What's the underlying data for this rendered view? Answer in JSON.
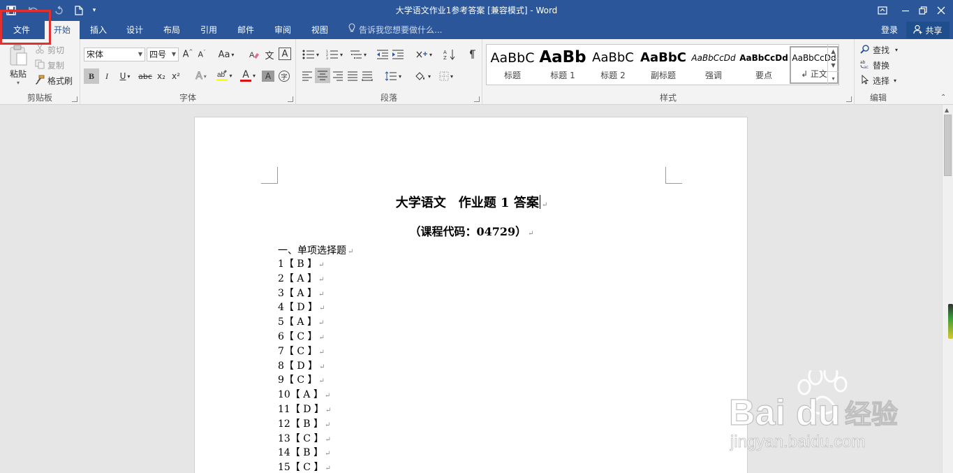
{
  "window": {
    "title": "大学语文作业1参考答案 [兼容模式] - Word"
  },
  "tabs": {
    "file": "文件",
    "items": [
      {
        "label": "开始",
        "active": true
      },
      {
        "label": "插入"
      },
      {
        "label": "设计"
      },
      {
        "label": "布局"
      },
      {
        "label": "引用"
      },
      {
        "label": "邮件"
      },
      {
        "label": "审阅"
      },
      {
        "label": "视图"
      }
    ],
    "tell_me": "告诉我您想要做什么...",
    "login": "登录",
    "share": "共享"
  },
  "ribbon": {
    "clipboard": {
      "label": "剪贴板",
      "paste": "粘贴",
      "cut": "剪切",
      "copy": "复制",
      "format_painter": "格式刷"
    },
    "font": {
      "label": "字体",
      "font_name": "宋体",
      "font_size": "四号",
      "change_case": "Aa",
      "bold": "B",
      "italic": "I",
      "underline": "U",
      "strikethrough": "abc",
      "subscript": "x₂",
      "superscript": "x²",
      "phonetic": "文",
      "char_border": "A",
      "font_color_letter": "A",
      "char_shading": "A",
      "enclose": "字"
    },
    "paragraph": {
      "label": "段落"
    },
    "styles": {
      "label": "样式",
      "items": [
        {
          "preview": "AaBbC",
          "name": "标题"
        },
        {
          "preview": "AaBb",
          "name": "标题 1"
        },
        {
          "preview": "AaBbC",
          "name": "标题 2"
        },
        {
          "preview": "AaBbC",
          "name": "副标题"
        },
        {
          "preview": "AaBbCcDd",
          "name": "强调"
        },
        {
          "preview": "AaBbCcDd",
          "name": "要点"
        },
        {
          "preview": "AaBbCcDd",
          "name": "↲ 正文"
        }
      ]
    },
    "editing": {
      "label": "编辑",
      "find": "查找",
      "replace": "替换",
      "select": "选择"
    }
  },
  "document": {
    "heading": "大学语文　作业题 1 答案",
    "subheading": "（课程代码：04729）",
    "section": "一、单项选择题",
    "paragraph_mark": "↵",
    "answers": [
      {
        "num": "1",
        "ans": "B"
      },
      {
        "num": "2",
        "ans": "A"
      },
      {
        "num": "3",
        "ans": "A"
      },
      {
        "num": "4",
        "ans": "D"
      },
      {
        "num": "5",
        "ans": "A"
      },
      {
        "num": "6",
        "ans": "C"
      },
      {
        "num": "7",
        "ans": "C"
      },
      {
        "num": "8",
        "ans": "D"
      },
      {
        "num": "9",
        "ans": "C"
      },
      {
        "num": "10",
        "ans": "A"
      },
      {
        "num": "11",
        "ans": "D"
      },
      {
        "num": "12",
        "ans": "B"
      },
      {
        "num": "13",
        "ans": "C"
      },
      {
        "num": "14",
        "ans": "B"
      },
      {
        "num": "15",
        "ans": "C"
      }
    ]
  },
  "watermark": {
    "brand": "Bai du 经验",
    "url": "jingyan.baidu.com"
  },
  "colors": {
    "title_bar": "#2b579a",
    "ribbon": "#f3f3f3",
    "highlight_box": "#e03030"
  }
}
